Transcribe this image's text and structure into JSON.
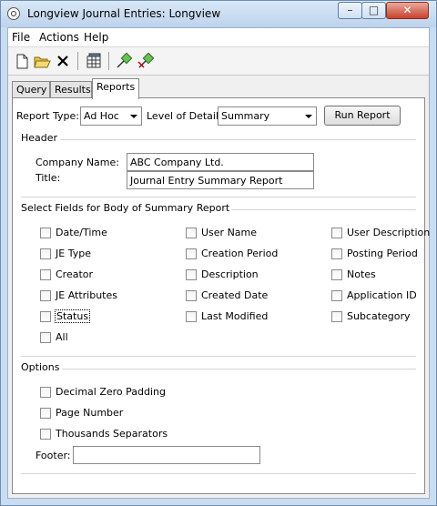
{
  "window": {
    "title": "Longview Journal Entries: Longview"
  },
  "menu": {
    "file": "File",
    "actions": "Actions",
    "help": "Help"
  },
  "tabs": {
    "query": "Query",
    "results": "Results",
    "reports": "Reports"
  },
  "report": {
    "type_label": "Report Type:",
    "type_value": "Ad Hoc",
    "detail_label": "Level of Detail:",
    "detail_value": "Summary",
    "run_button": "Run Report"
  },
  "header": {
    "section": "Header",
    "company_label": "Company Name:",
    "company_value": "ABC Company Ltd.",
    "title_label": "Title:",
    "title_value": "Journal Entry Summary Report"
  },
  "fields": {
    "section": "Select Fields for Body of Summary Report",
    "col1": [
      "Date/Time",
      "JE Type",
      "Creator",
      "JE Attributes",
      "Status",
      "All"
    ],
    "col2": [
      "User Name",
      "Creation Period",
      "Description",
      "Created Date",
      "Last Modified"
    ],
    "col3": [
      "User Description",
      "Posting Period",
      "Notes",
      "Application ID",
      "Subcategory"
    ]
  },
  "options": {
    "section": "Options",
    "items": [
      "Decimal Zero Padding",
      "Page Number",
      "Thousands Separators"
    ],
    "footer_label": "Footer:",
    "footer_value": ""
  }
}
